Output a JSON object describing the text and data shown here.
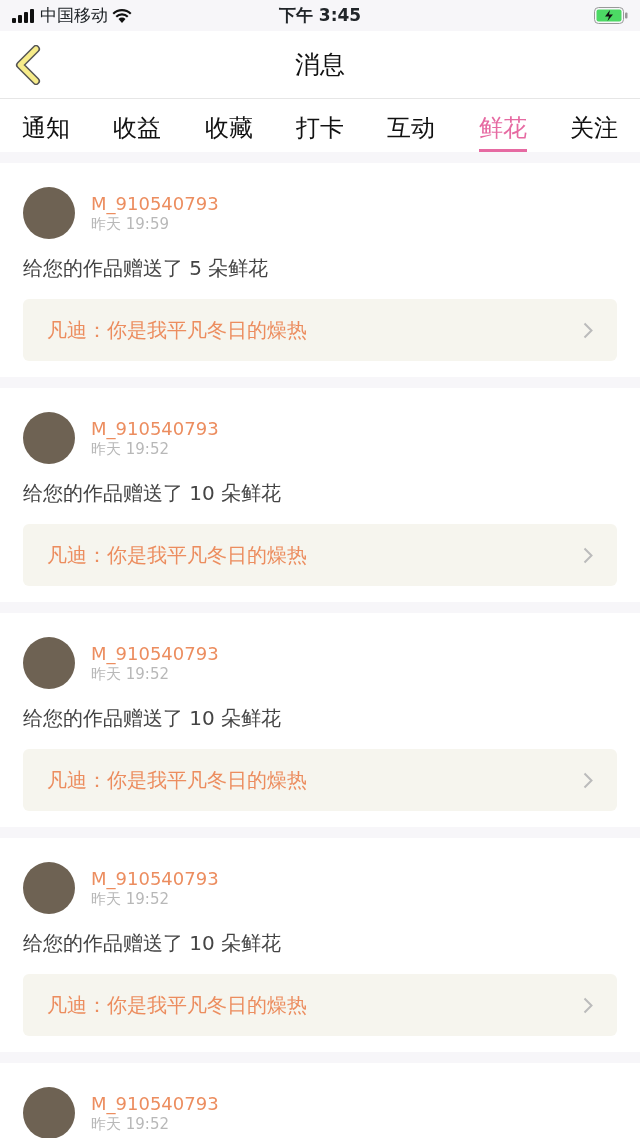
{
  "status_bar": {
    "carrier": "中国移动",
    "time": "下午 3:45"
  },
  "header": {
    "title": "消息"
  },
  "tabs": [
    {
      "label": "通知",
      "selected": false
    },
    {
      "label": "收益",
      "selected": false
    },
    {
      "label": "收藏",
      "selected": false
    },
    {
      "label": "打卡",
      "selected": false
    },
    {
      "label": "互动",
      "selected": false
    },
    {
      "label": "鲜花",
      "selected": true
    },
    {
      "label": "关注",
      "selected": false
    }
  ],
  "messages": [
    {
      "user": "M_910540793",
      "time": "昨天 19:59",
      "text": "给您的作品赠送了 5 朵鲜花",
      "work": "凡迪：你是我平凡冬日的燥热"
    },
    {
      "user": "M_910540793",
      "time": "昨天 19:52",
      "text": "给您的作品赠送了 10 朵鲜花",
      "work": "凡迪：你是我平凡冬日的燥热"
    },
    {
      "user": "M_910540793",
      "time": "昨天 19:52",
      "text": "给您的作品赠送了 10 朵鲜花",
      "work": "凡迪：你是我平凡冬日的燥热"
    },
    {
      "user": "M_910540793",
      "time": "昨天 19:52",
      "text": "给您的作品赠送了 10 朵鲜花",
      "work": "凡迪：你是我平凡冬日的燥热"
    },
    {
      "user": "M_910540793",
      "time": "昨天 19:52"
    }
  ]
}
